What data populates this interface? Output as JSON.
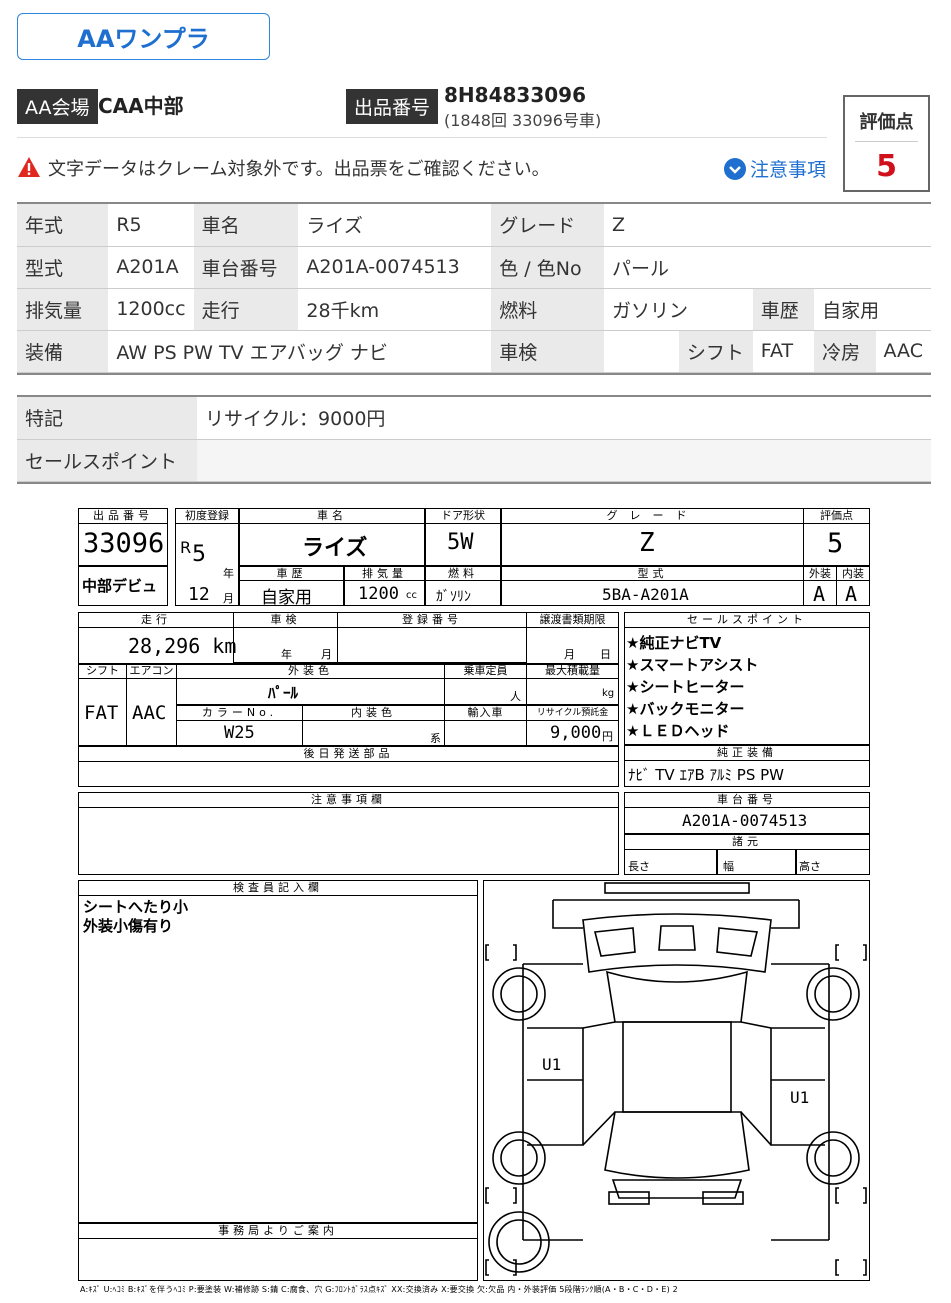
{
  "header": {
    "brand_button": "AAワンプラ",
    "venue_tag": "AA会場",
    "venue_value": "CAA中部",
    "lot_tag": "出品番号",
    "lot_value": "8H84833096",
    "lot_sub": "(1848回 33096号車)",
    "score_label": "評価点",
    "score_value": "5",
    "warning_text": "文字データはクレーム対象外です。出品票をご確認ください。",
    "notes_link": "注意事項"
  },
  "spec": {
    "row1": [
      "年式",
      "R5",
      "車名",
      "ライズ",
      "グレード",
      "Z"
    ],
    "row2": [
      "型式",
      "A201A",
      "車台番号",
      "A201A-0074513",
      "色 / 色No",
      "パール"
    ],
    "row3": [
      "排気量",
      "1200cc",
      "走行",
      "28千km",
      "燃料",
      "ガソリン",
      "車歴",
      "自家用"
    ],
    "row4": [
      "装備",
      "AW PS PW TV エアバッグ ナビ",
      "車検",
      "",
      "シフト",
      "FAT",
      "冷房",
      "AAC"
    ]
  },
  "remarks": {
    "special_label": "特記",
    "special_value": "リサイクル：9000円",
    "sales_label": "セールスポイント",
    "sales_value": ""
  },
  "sheet": {
    "h_lot": "出品番号",
    "lot": "33096",
    "venue": "中部デビュ",
    "h_first_reg": "初度登録",
    "era": "R",
    "year": "5",
    "year_unit": "年",
    "month": "12",
    "month_unit": "月",
    "h_car_name": "車名",
    "car_name": "ライズ",
    "h_door": "ドア形状",
    "door": "5W",
    "h_grade": "グレード",
    "grade": "Z",
    "h_score": "評価点",
    "score": "5",
    "h_history": "車歴",
    "history": "自家用",
    "h_displacement": "排気量",
    "displacement": "1200",
    "cc": "cc",
    "h_fuel": "燃料",
    "fuel": "ｶﾞｿﾘﾝ",
    "h_model": "型式",
    "model": "5BA-A201A",
    "h_ext": "外装",
    "ext": "A",
    "h_int": "内装",
    "int": "A",
    "h_mileage": "走行",
    "mileage": "28,296 km",
    "h_inspection": "車検",
    "insp_year": "年",
    "insp_month": "月",
    "h_plate": "登録番号",
    "h_transfer": "譲渡書類期限",
    "transfer_month": "月",
    "transfer_day": "日",
    "h_shift": "シフト",
    "shift": "FAT",
    "h_ac": "エアコン",
    "ac": "AAC",
    "h_color": "外装色",
    "color": "ﾊﾟｰﾙ",
    "h_capacity": "乗車定員",
    "capacity_unit": "人",
    "h_load": "最大積載量",
    "load_unit": "kg",
    "h_color_no": "カラーNo.",
    "color_no": "W25",
    "h_interior_color": "内装色",
    "interior_unit": "系",
    "h_import": "輸入車",
    "h_recycle": "リサイクル預託金",
    "recycle": "9,000",
    "recycle_unit": "円",
    "h_later_parts": "後日発送部品",
    "h_sales": "セールスポイント",
    "sales_points": [
      "★純正ナビTV",
      "★スマートアシスト",
      "★シートヒーター",
      "★バックモニター",
      "★ＬＥＤヘッド"
    ],
    "h_genuine": "純正装備",
    "genuine": "ﾅﾋﾞ TV ｴｱB ｱﾙﾐ PS PW",
    "h_caution": "注意事項欄",
    "h_chassis": "車台番号",
    "chassis": "A201A-0074513",
    "h_dims": "諸元",
    "dim_length": "長さ",
    "dim_width": "幅",
    "dim_height": "高さ",
    "h_inspector": "検査員記入欄",
    "inspector_notes": [
      "シートへたり小",
      "外装小傷有り"
    ],
    "h_office": "事務局よりご案内",
    "damage_u1_left": "U1",
    "damage_u1_right": "U1",
    "legend": "A:ｷｽﾞ U:ﾍｺﾐ B:ｷｽﾞを伴うﾍｺﾐ P:要塗装 W:補修跡 S:錆 C:腐食、穴 G:ﾌﾛﾝﾄｶﾞﾗｽ点ｷｽﾞ XX:交換済み X:要交換 欠:欠品 内・外装評価 5段階ﾗﾝｸ順(A・B・C・D・E) 2"
  },
  "colors": {
    "accent": "#1e6fd0",
    "score": "#d0101a",
    "warning": "#e0281e",
    "key_bg": "#eaeaea"
  }
}
